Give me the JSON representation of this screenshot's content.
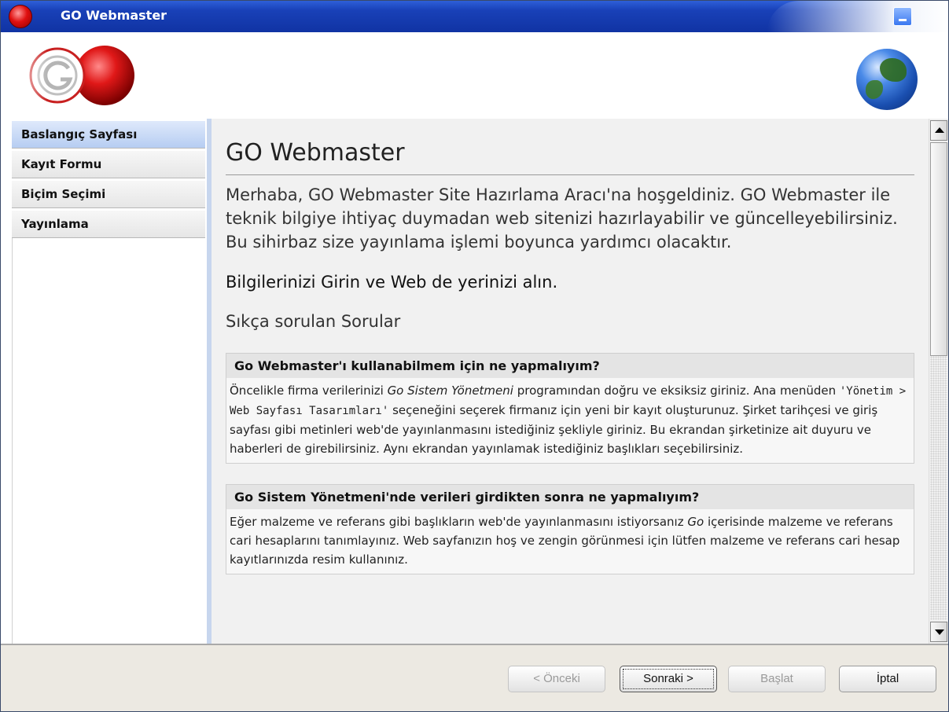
{
  "window": {
    "title": "GO Webmaster"
  },
  "sidebar": {
    "items": [
      {
        "label": "Baslangıç Sayfası",
        "active": true
      },
      {
        "label": "Kayıt Formu"
      },
      {
        "label": "Biçim Seçimi"
      },
      {
        "label": "Yayınlama"
      }
    ]
  },
  "content": {
    "title": "GO Webmaster",
    "intro": "Merhaba, GO Webmaster Site Hazırlama Aracı'na hoşgeldiniz. GO Webmaster ile teknik bilgiye ihtiyaç duymadan web sitenizi hazırlayabilir ve güncelleyebilirsiniz. Bu sihirbaz size yayınlama işlemi boyunca yardımcı olacaktır.",
    "tagline": "Bilgilerinizi Girin ve Web de yerinizi alın.",
    "faq_heading": "Sıkça sorulan Sorular",
    "faq": [
      {
        "question": "Go Webmaster'ı kullanabilmem için ne yapmalıyım?",
        "a1": "Öncelikle firma verilerinizi ",
        "a1_em": "Go Sistem Yönetmeni",
        "a2": " programından doğru ve eksiksiz giriniz. Ana menüden ",
        "a2_code": "'Yönetim > Web Sayfası Tasarımları'",
        "a3": " seçeneğini seçerek firmanız için yeni bir kayıt oluşturunuz. Şirket tarihçesi ve giriş sayfası gibi metinleri web'de yayınlanmasını istediğiniz şekliyle giriniz. Bu ekrandan şirketinize ait duyuru ve haberleri de girebilirsiniz. Aynı ekrandan yayınlamak istediğiniz başlıkları seçebilirsiniz."
      },
      {
        "question": "Go Sistem Yönetmeni'nde verileri girdikten sonra ne yapmalıyım?",
        "a1": "Eğer malzeme ve referans gibi başlıkların web'de yayınlanmasını istiyorsanız ",
        "a1_em": "Go",
        "a2": " içerisinde malzeme ve referans cari hesaplarını tanımlayınız. Web sayfanızın hoş ve zengin görünmesi için lütfen malzeme ve referans cari hesap kayıtlarınızda resim kullanınız."
      }
    ]
  },
  "footer": {
    "prev": "< Önceki",
    "next": "Sonraki >",
    "start": "Başlat",
    "cancel": "İptal"
  },
  "icons": {
    "app": "red-orb-icon",
    "logo": "go-logo",
    "globe": "globe-icon",
    "minimize": "minimize-icon"
  }
}
